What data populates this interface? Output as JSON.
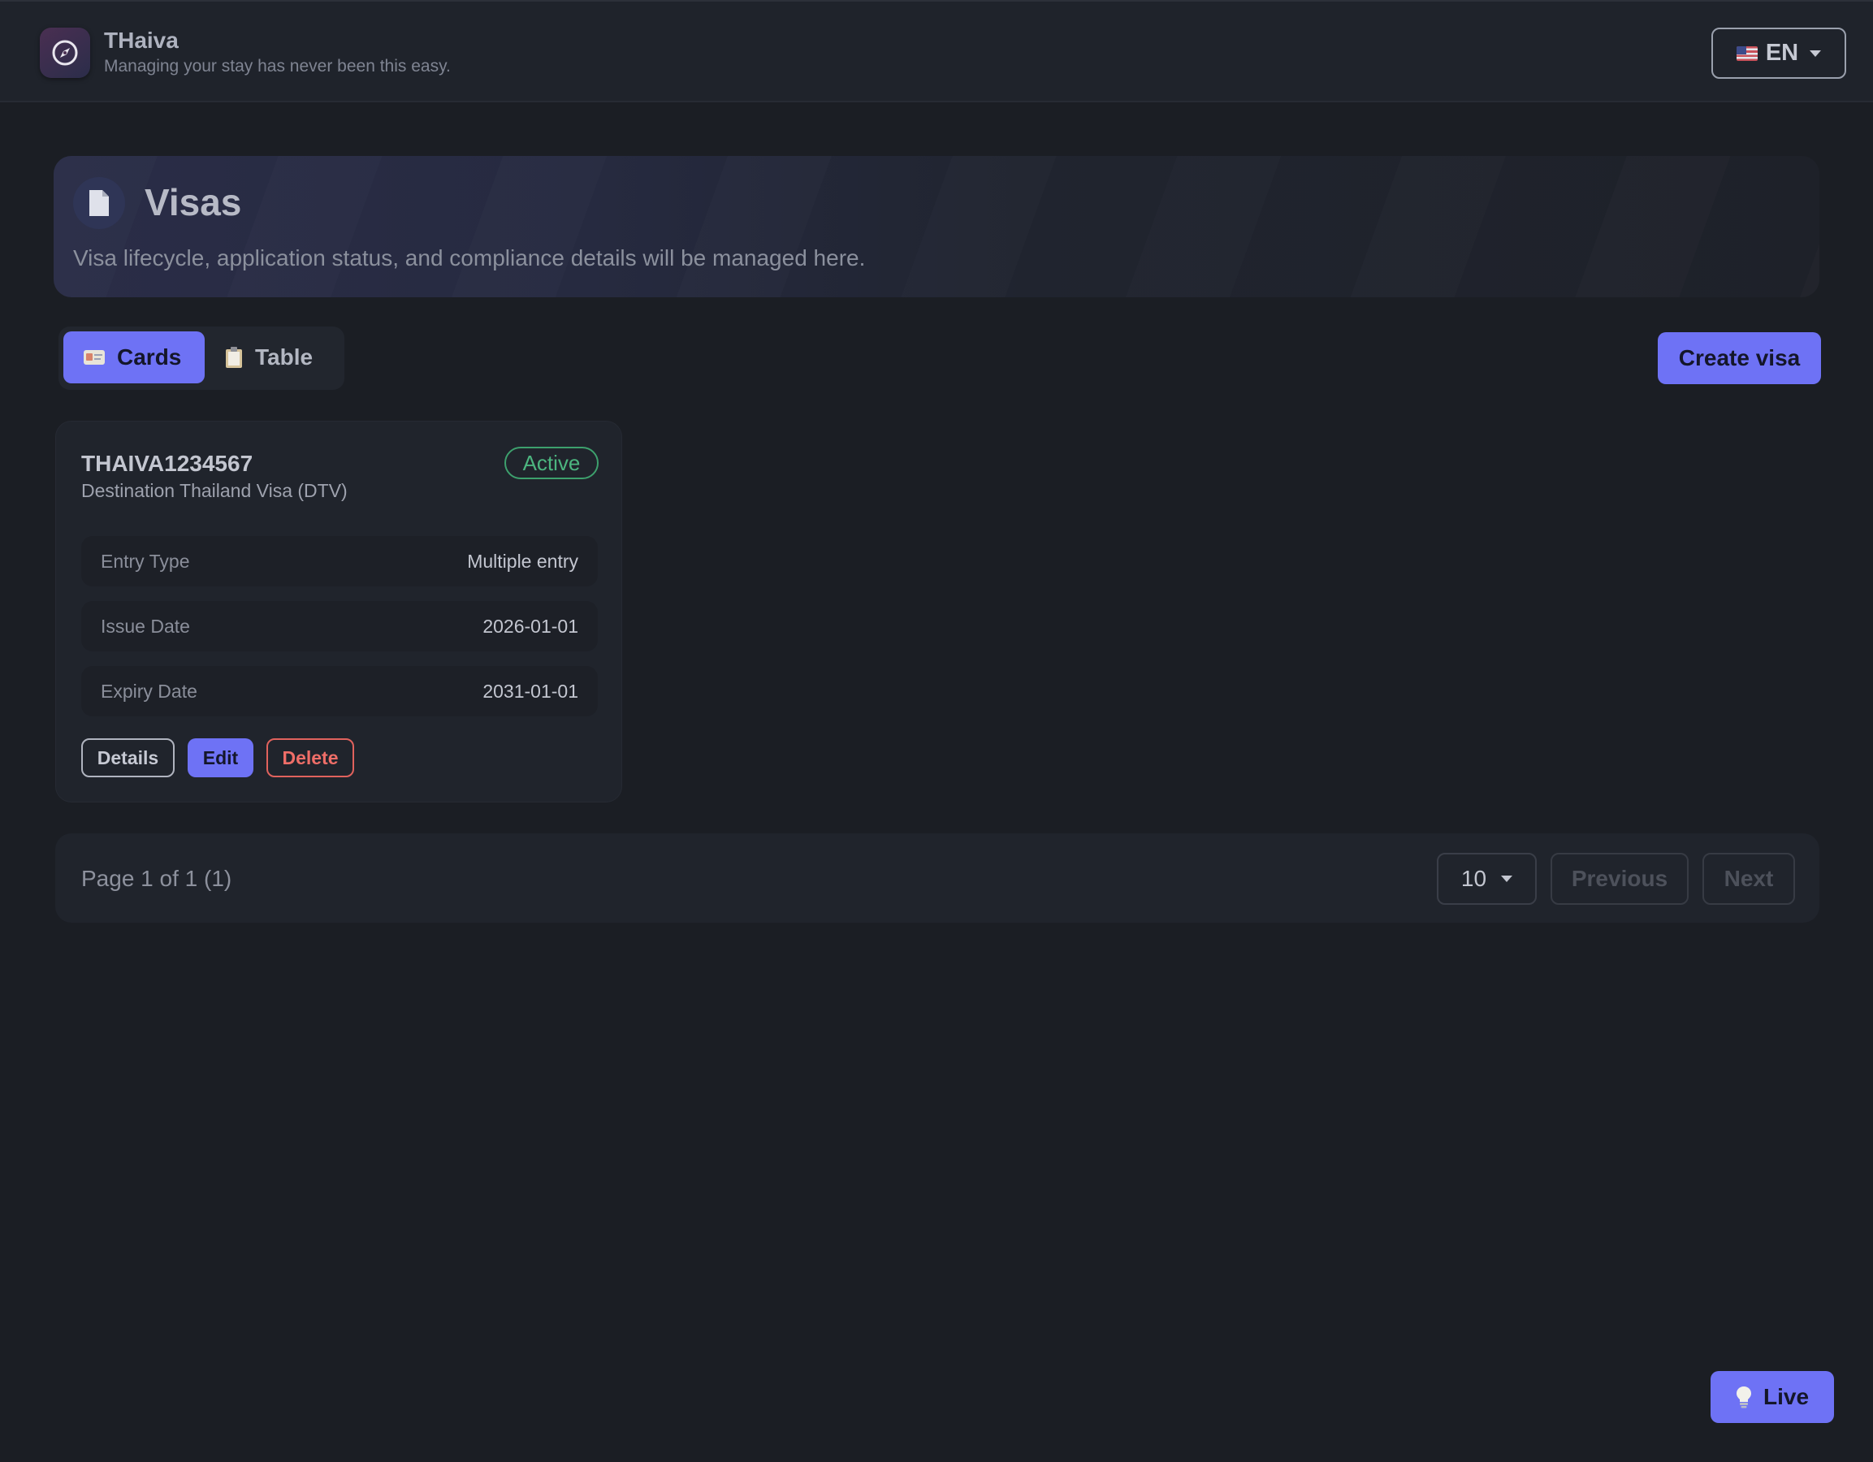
{
  "header": {
    "app_title": "THaiva",
    "app_subtitle": "Managing your stay has never been this easy.",
    "language": "EN",
    "logo_icon": "compass-icon",
    "flag_icon": "us-flag-icon"
  },
  "hero": {
    "icon": "document-icon",
    "title": "Visas",
    "description": "Visa lifecycle, application status, and compliance details will be managed here."
  },
  "view_toggle": {
    "active": "cards",
    "cards_label": "Cards",
    "table_label": "Table"
  },
  "actions": {
    "create_label": "Create visa"
  },
  "visa_cards": [
    {
      "number": "THAIVA1234567",
      "type": "Destination Thailand Visa (DTV)",
      "status": "Active",
      "fields": [
        {
          "label": "Entry Type",
          "value": "Multiple entry"
        },
        {
          "label": "Issue Date",
          "value": "2026-01-01"
        },
        {
          "label": "Expiry Date",
          "value": "2031-01-01"
        }
      ],
      "buttons": {
        "details": "Details",
        "edit": "Edit",
        "delete": "Delete"
      }
    }
  ],
  "pagination": {
    "info": "Page 1 of 1 (1)",
    "page_size": "10",
    "previous_label": "Previous",
    "next_label": "Next"
  },
  "live_button": {
    "label": "Live",
    "icon": "lightbulb-icon"
  },
  "colors": {
    "accent": "#6e72f5",
    "background": "#1b1e24",
    "success": "#4cb57f",
    "danger": "#ef6e68"
  }
}
